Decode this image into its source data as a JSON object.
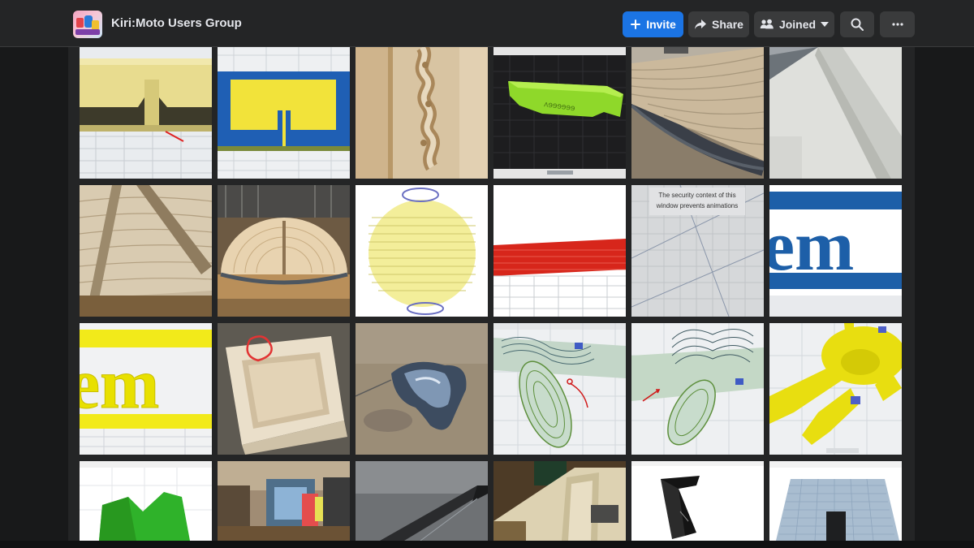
{
  "header": {
    "group_name": "Kiri:Moto Users Group",
    "invite_label": "Invite",
    "share_label": "Share",
    "joined_label": "Joined"
  },
  "icons": {
    "invite": "plus-icon",
    "share": "share-arrow-icon",
    "joined": "people-icon",
    "joined_menu": "caret-down-icon",
    "search": "search-icon",
    "more": "more-dots-icon"
  },
  "colors": {
    "primary": "#1b74e4",
    "bar": "#242526",
    "page": "#18191a",
    "button": "#3a3b3c",
    "text": "#e4e6eb"
  },
  "photos": {
    "security_notice": "The security context of this window prevents animations",
    "word_em": "em"
  }
}
